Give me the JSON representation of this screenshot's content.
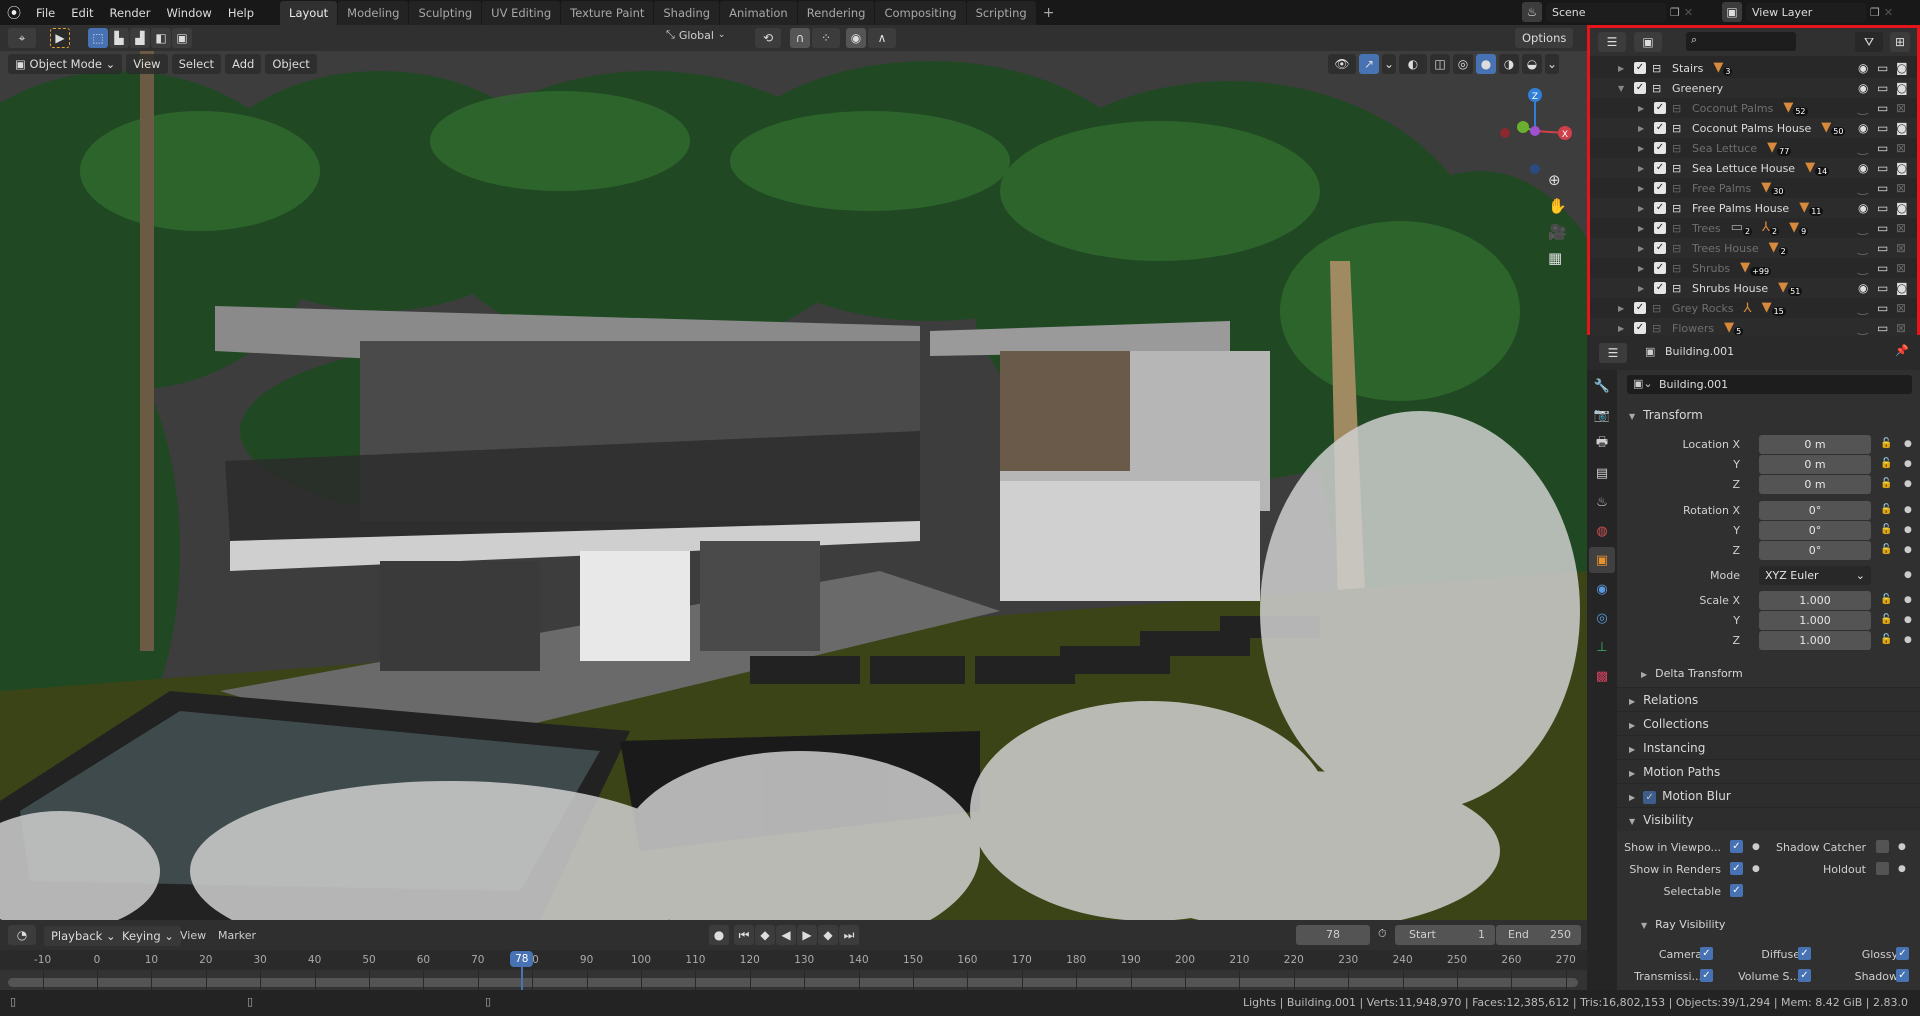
{
  "topbar": {
    "logo": "blender-logo",
    "menus": [
      "File",
      "Edit",
      "Render",
      "Window",
      "Help"
    ],
    "workspaces": [
      "Layout",
      "Modeling",
      "Sculpting",
      "UV Editing",
      "Texture Paint",
      "Shading",
      "Animation",
      "Rendering",
      "Compositing",
      "Scripting"
    ],
    "active_workspace": "Layout",
    "add_workspace": "+",
    "scene": "Scene",
    "view_layer": "View Layer"
  },
  "tool_header": {
    "transform_orientation": "Global",
    "options": "Options"
  },
  "viewport_header": {
    "mode": "Object Mode",
    "menus": [
      "View",
      "Select",
      "Add",
      "Object"
    ]
  },
  "navigation_gizmo": {
    "axes": [
      "X",
      "Y",
      "Z"
    ]
  },
  "outliner": {
    "search_placeholder": "",
    "rows": [
      {
        "name": "Stairs",
        "depth": 0,
        "dim": false,
        "expanded": false,
        "badges": [
          {
            "icon": "mesh",
            "count": "3"
          }
        ]
      },
      {
        "name": "Greenery",
        "depth": 0,
        "dim": false,
        "expanded": true,
        "badges": []
      },
      {
        "name": "Coconut Palms",
        "depth": 1,
        "dim": true,
        "badges": [
          {
            "icon": "mesh",
            "count": "52"
          }
        ]
      },
      {
        "name": "Coconut Palms House",
        "depth": 1,
        "dim": false,
        "badges": [
          {
            "icon": "mesh",
            "count": "50"
          }
        ]
      },
      {
        "name": "Sea Lettuce",
        "depth": 1,
        "dim": true,
        "badges": [
          {
            "icon": "mesh",
            "count": "77"
          }
        ]
      },
      {
        "name": "Sea Lettuce House",
        "depth": 1,
        "dim": false,
        "badges": [
          {
            "icon": "mesh",
            "count": "14"
          }
        ]
      },
      {
        "name": "Free Palms",
        "depth": 1,
        "dim": true,
        "badges": [
          {
            "icon": "mesh",
            "count": "30"
          }
        ]
      },
      {
        "name": "Free Palms House",
        "depth": 1,
        "dim": false,
        "badges": [
          {
            "icon": "mesh",
            "count": "11"
          }
        ]
      },
      {
        "name": "Trees",
        "depth": 1,
        "dim": true,
        "badges": [
          {
            "icon": "collection",
            "count": "2"
          },
          {
            "icon": "armature",
            "count": "2"
          },
          {
            "icon": "mesh",
            "count": "9"
          }
        ]
      },
      {
        "name": "Trees House",
        "depth": 1,
        "dim": true,
        "badges": [
          {
            "icon": "mesh",
            "count": "2"
          }
        ]
      },
      {
        "name": "Shrubs",
        "depth": 1,
        "dim": true,
        "badges": [
          {
            "icon": "mesh",
            "count": "+99"
          }
        ]
      },
      {
        "name": "Shrubs House",
        "depth": 1,
        "dim": false,
        "badges": [
          {
            "icon": "mesh",
            "count": "51"
          }
        ]
      },
      {
        "name": "Grey Rocks",
        "depth": 0,
        "dim": true,
        "badges": [
          {
            "icon": "armature",
            "count": ""
          },
          {
            "icon": "mesh",
            "count": "15"
          }
        ]
      },
      {
        "name": "Flowers",
        "depth": 0,
        "dim": true,
        "badges": [
          {
            "icon": "mesh",
            "count": "5"
          }
        ]
      }
    ]
  },
  "properties": {
    "object_name": "Building.001",
    "datablock_name": "Building.001",
    "transform": {
      "title": "Transform",
      "location": {
        "label": "Location X",
        "x": "0 m",
        "y": "0 m",
        "z": "0 m"
      },
      "rotation": {
        "label": "Rotation X",
        "x": "0°",
        "y": "0°",
        "z": "0°"
      },
      "mode": {
        "label": "Mode",
        "value": "XYZ Euler"
      },
      "scale": {
        "label": "Scale X",
        "x": "1.000",
        "y": "1.000",
        "z": "1.000"
      },
      "y_label": "Y",
      "z_label": "Z",
      "delta": "Delta Transform"
    },
    "sections": [
      "Relations",
      "Collections",
      "Instancing",
      "Motion Paths",
      "Motion Blur"
    ],
    "motion_blur_enabled": true,
    "visibility": {
      "title": "Visibility",
      "show_viewport": "Show in Viewpo...",
      "show_renders": "Show in Renders",
      "selectable": "Selectable",
      "shadow_catcher": "Shadow Catcher",
      "holdout": "Holdout",
      "show_viewport_on": true,
      "show_renders_on": true,
      "selectable_on": true,
      "shadow_catcher_on": false,
      "holdout_on": false
    },
    "ray_visibility": {
      "title": "Ray Visibility",
      "camera": "Camera",
      "diffuse": "Diffuse",
      "glossy": "Glossy",
      "transmission": "Transmissi...",
      "volume": "Volume S...",
      "shadow": "Shadow"
    }
  },
  "timeline": {
    "menus": [
      "Playback",
      "Keying",
      "View",
      "Marker"
    ],
    "current_frame": "78",
    "start_label": "Start",
    "start": "1",
    "end_label": "End",
    "end": "250",
    "ticks": [
      -10,
      0,
      10,
      20,
      30,
      40,
      50,
      60,
      70,
      80,
      90,
      100,
      110,
      120,
      130,
      140,
      150,
      160,
      170,
      180,
      190,
      200,
      210,
      220,
      230,
      240,
      250,
      260,
      270
    ]
  },
  "status": "Lights | Building.001 | Verts:11,948,970 | Faces:12,385,612 | Tris:16,802,153 | Objects:39/1,294 | Mem: 8.42 GiB | 2.83.0",
  "colors": {
    "accent": "#4772b3",
    "highlight": "#e8141c",
    "mesh_badge": "#d88a3c"
  }
}
